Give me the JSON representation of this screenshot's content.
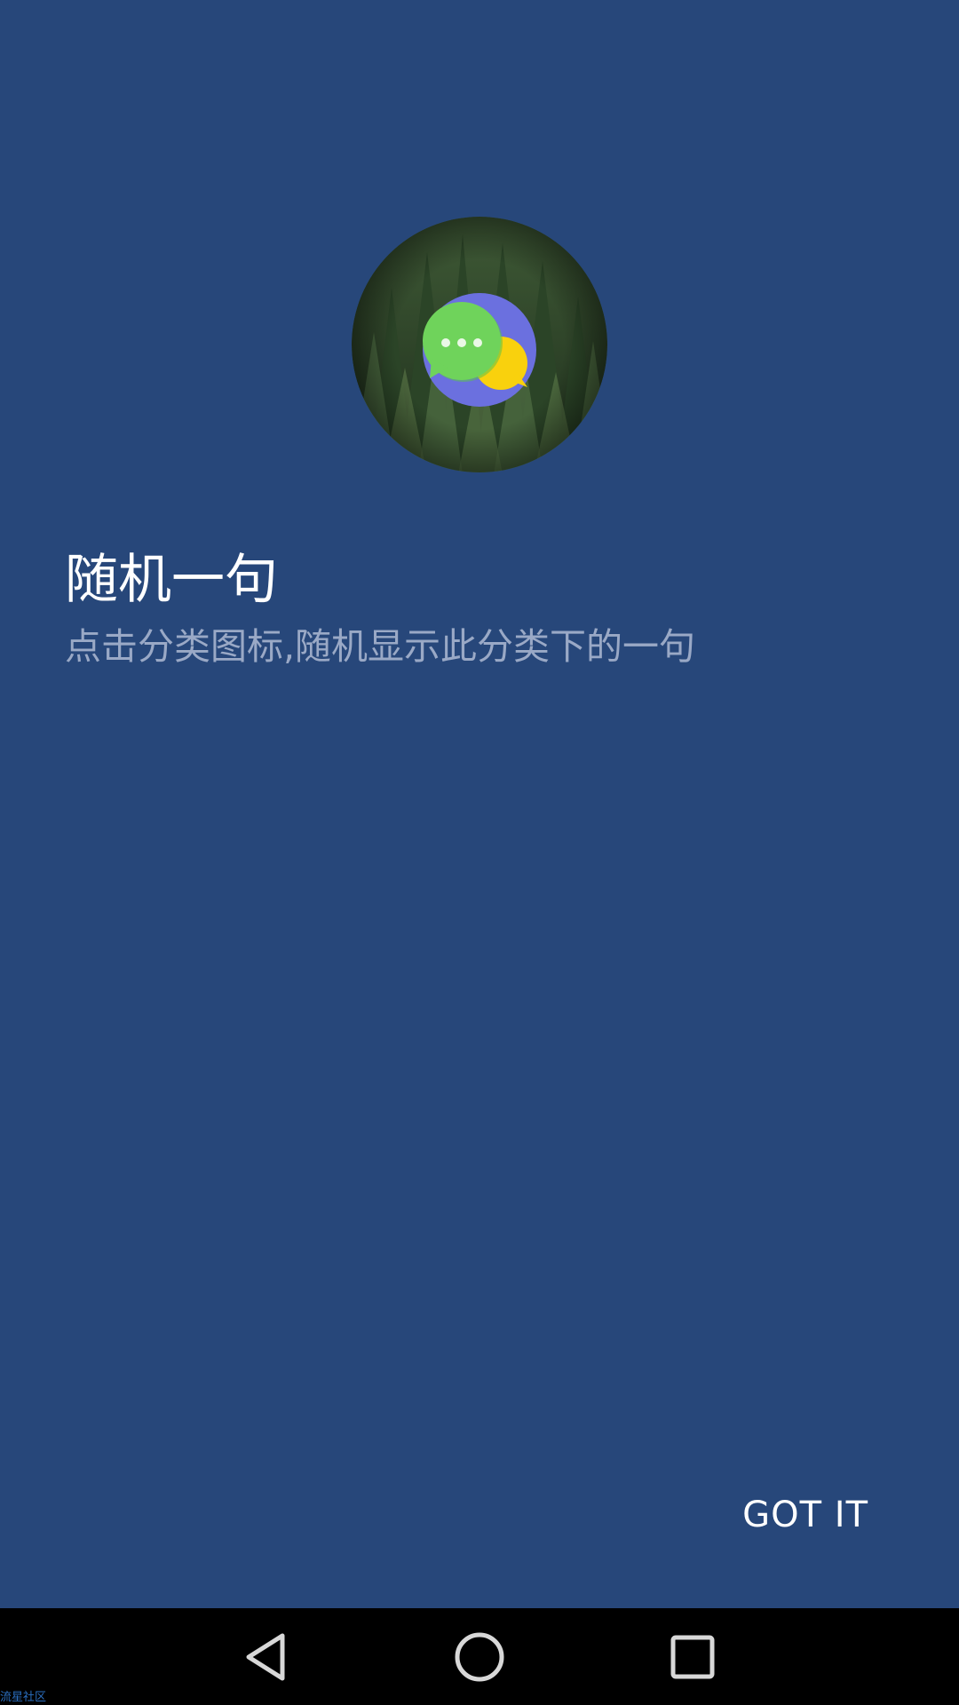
{
  "hero": {
    "icon": "chat-bubbles-icon",
    "background": "forest-photo"
  },
  "intro": {
    "title": "随机一句",
    "description": "点击分类图标,随机显示此分类下的一句"
  },
  "actions": {
    "got_it_label": "GOT IT"
  },
  "navbar": {
    "back_icon": "back-triangle-icon",
    "home_icon": "home-circle-icon",
    "recents_icon": "recents-square-icon"
  },
  "watermark": "流星社区",
  "colors": {
    "background": "#27477a",
    "title": "#ffffff",
    "subtitle": "#9aa9c6",
    "navbar": "#000000",
    "badge_circle": "#6b70df",
    "bubble_green": "#6fd35b",
    "bubble_yellow": "#f9d10d",
    "watermark": "#2b6fc0"
  }
}
